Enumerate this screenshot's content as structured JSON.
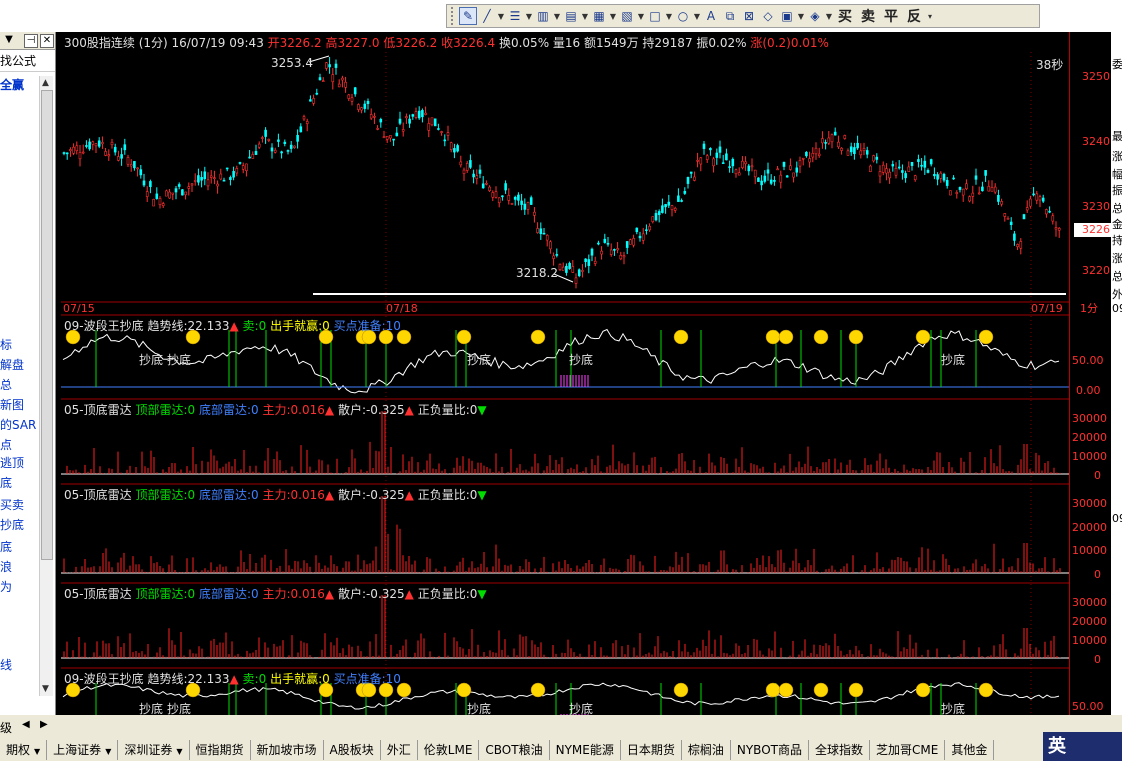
{
  "toolbar": {
    "trade_buttons": [
      "买",
      "卖",
      "平",
      "反"
    ],
    "tools": [
      "select-tool",
      "line-tool",
      "channel-tool",
      "bar-tool",
      "fib-tool",
      "gann-tool",
      "cycle-tool",
      "rect-tool",
      "ellipse-tool",
      "text-tool",
      "copy-tool",
      "erase-tool",
      "hide-tool",
      "color-tool",
      "layer-tool"
    ]
  },
  "left_panel": {
    "title": "找公式",
    "items": [
      "全赢",
      "标",
      "解盘",
      "总",
      "新图",
      "的SAR",
      "点",
      "逃顶",
      "底",
      "买卖",
      "抄底",
      "底",
      "浪",
      "为",
      "线"
    ]
  },
  "chart": {
    "symbol_header": {
      "name": "300股指连续 (1分) 16/07/19 09:43",
      "open": "开3226.2",
      "high": "高3227.0",
      "low": "低3226.2",
      "close": "收3226.4",
      "turnover": "换0.05%",
      "volume": "量16",
      "amount": "额1549万",
      "position": "持29187",
      "amplitude": "振0.02%",
      "change": "涨(0.2)0.01%"
    },
    "countdown": "38秒",
    "annotations": {
      "high_label": "3253.4",
      "low_label": "3218.2"
    },
    "dates": {
      "d1": "07/15",
      "d2": "07/18",
      "d3": "07/19"
    },
    "price_axis": {
      "ticks": [
        "3250",
        "3240",
        "3230",
        "3220"
      ],
      "current": "3226",
      "unit": "1分"
    },
    "panels": [
      {
        "title": "09-波段王抄底",
        "p1": "趋势线:22.133",
        "p2": "卖:0",
        "p3": "出手就赢:0",
        "p4": "买点准备:10",
        "ticks": [
          "50.00",
          "0.00"
        ],
        "signal": "抄底"
      },
      {
        "title": "05-顶底雷达",
        "p1": "顶部雷达:0",
        "p2": "底部雷达:0",
        "p3": "主力:0.016",
        "p4": "散户:-0.325",
        "p5": "正负量比:0",
        "ticks": [
          "30000",
          "20000",
          "10000",
          "0"
        ]
      },
      {
        "title": "05-顶底雷达",
        "p1": "顶部雷达:0",
        "p2": "底部雷达:0",
        "p3": "主力:0.016",
        "p4": "散户:-0.325",
        "p5": "正负量比:0",
        "ticks": [
          "30000",
          "20000",
          "10000",
          "0"
        ]
      },
      {
        "title": "05-顶底雷达",
        "p1": "顶部雷达:0",
        "p2": "底部雷达:0",
        "p3": "主力:0.016",
        "p4": "散户:-0.325",
        "p5": "正负量比:0",
        "ticks": [
          "30000",
          "20000",
          "10000",
          "0"
        ]
      },
      {
        "title": "09-波段王抄底",
        "p1": "趋势线:22.133",
        "p2": "卖:0",
        "p3": "出手就赢:0",
        "p4": "买点准备:10",
        "ticks": [
          "50.00"
        ],
        "signal": "抄底"
      }
    ],
    "right_stub": [
      "委",
      "最",
      "涨",
      "幅",
      "振",
      "总",
      "金",
      "持",
      "涨",
      "总",
      "外",
      "09",
      "09"
    ]
  },
  "bottom_tabs": [
    "期权",
    "上海证券",
    "深圳证券",
    "恒指期货",
    "新加坡市场",
    "A股板块",
    "外汇",
    "伦敦LME",
    "CBOT粮油",
    "NYME能源",
    "日本期货",
    "棕榈油",
    "NYBOT商品",
    "全球指数",
    "芝加哥CME",
    "其他金"
  ],
  "bottom_tab_dropdowns": [
    true,
    true,
    true,
    false,
    false,
    false,
    false,
    false,
    false,
    false,
    false,
    false,
    false,
    false,
    false,
    false
  ],
  "ime": "英",
  "colors": {
    "up": "#ff3030",
    "down": "#00ffff",
    "accent_green": "#00dd00",
    "accent_yellow": "#ffff00",
    "accent_blue": "#4080ff"
  }
}
